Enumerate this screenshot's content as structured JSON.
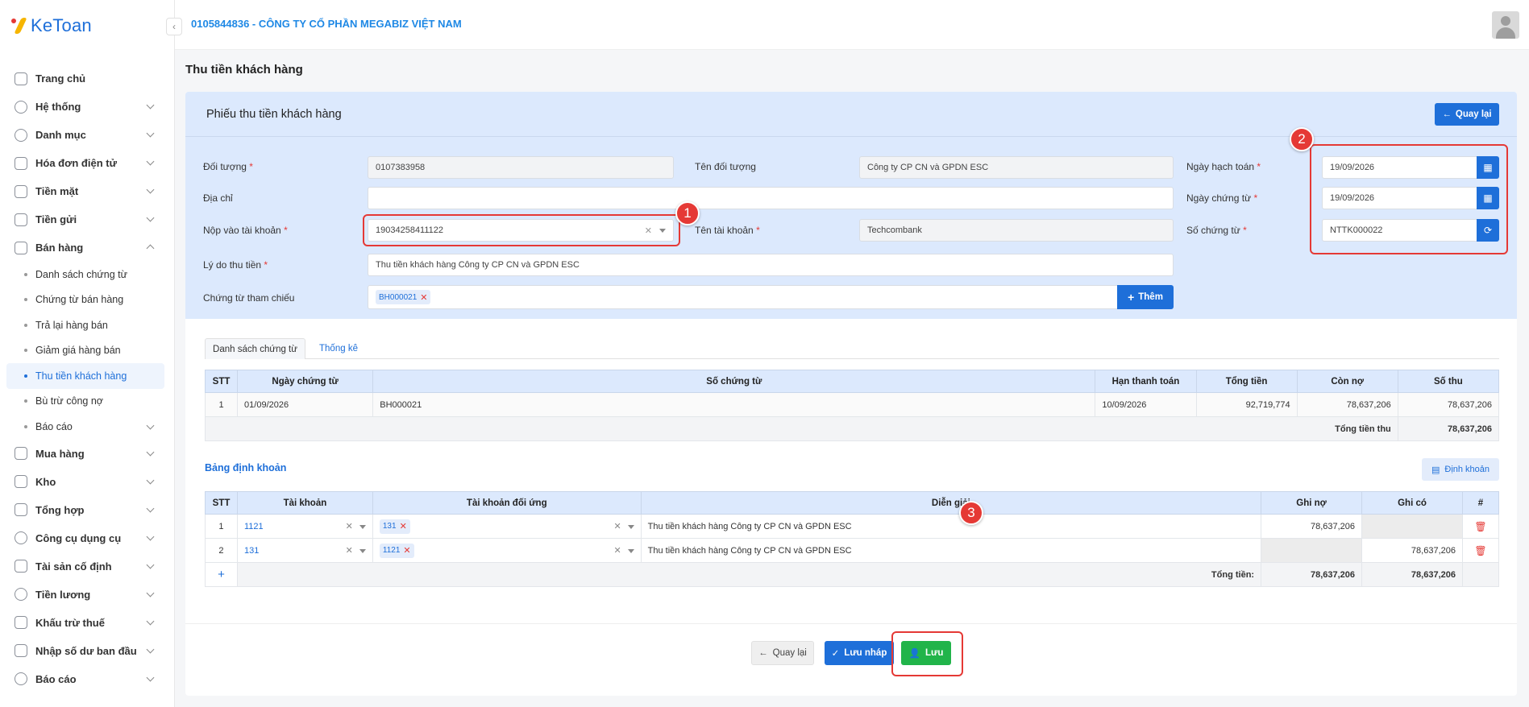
{
  "app": {
    "logo": "KeToan",
    "company": "0105844836 - CÔNG TY CỔ PHẦN MEGABIZ VIỆT NAM"
  },
  "sidebar": {
    "items": [
      {
        "label": "Trang chủ",
        "icon": "home-icon",
        "expand": ""
      },
      {
        "label": "Hệ thống",
        "icon": "gear-icon",
        "expand": "down"
      },
      {
        "label": "Danh mục",
        "icon": "grid-icon",
        "expand": "down"
      },
      {
        "label": "Hóa đơn điện tử",
        "icon": "invoice-icon",
        "expand": "down"
      },
      {
        "label": "Tiền mặt",
        "icon": "cash-icon",
        "expand": "down"
      },
      {
        "label": "Tiền gửi",
        "icon": "bank-icon",
        "expand": "down"
      },
      {
        "label": "Bán hàng",
        "icon": "sales-icon",
        "expand": "up"
      }
    ],
    "sales_sub": [
      {
        "label": "Danh sách chứng từ"
      },
      {
        "label": "Chứng từ bán hàng"
      },
      {
        "label": "Trả lại hàng bán"
      },
      {
        "label": "Giảm giá hàng bán"
      },
      {
        "label": "Thu tiền khách hàng"
      },
      {
        "label": "Bù trừ công nợ"
      },
      {
        "label": "Báo cáo"
      }
    ],
    "items_after": [
      {
        "label": "Mua hàng",
        "icon": "cart-icon"
      },
      {
        "label": "Kho",
        "icon": "warehouse-icon"
      },
      {
        "label": "Tổng hợp",
        "icon": "chart-line-icon"
      },
      {
        "label": "Công cụ dụng cụ",
        "icon": "tools-icon"
      },
      {
        "label": "Tài sản cố định",
        "icon": "car-icon"
      },
      {
        "label": "Tiền lương",
        "icon": "dollar-icon"
      },
      {
        "label": "Khấu trừ thuế",
        "icon": "tax-icon"
      },
      {
        "label": "Nhập số dư ban đầu",
        "icon": "balance-icon"
      },
      {
        "label": "Báo cáo",
        "icon": "report-icon"
      }
    ]
  },
  "page": {
    "title": "Thu tiền khách hàng"
  },
  "form": {
    "card_title": "Phiếu thu tiền khách hàng",
    "back_label": "Quay lại",
    "req": "*",
    "doi_tuong": {
      "label": "Đối tượng",
      "value": "0107383958"
    },
    "ten_doi_tuong": {
      "label": "Tên đối tượng",
      "value": "Công ty CP CN và GPDN ESC"
    },
    "ngay_hach_toan": {
      "label": "Ngày hạch toán",
      "value": "19/09/2026"
    },
    "dia_chi": {
      "label": "Địa chỉ",
      "value": ""
    },
    "ngay_chung_tu": {
      "label": "Ngày chứng từ",
      "value": "19/09/2026"
    },
    "nop_vao_tk": {
      "label": "Nộp vào tài khoản",
      "value": "19034258411122"
    },
    "ten_tk": {
      "label": "Tên tài khoản",
      "value": "Techcombank"
    },
    "so_chung_tu": {
      "label": "Số chứng từ",
      "value": "NTTK000022"
    },
    "ly_do": {
      "label": "Lý do thu tiền",
      "value": "Thu tiền khách hàng Công ty CP CN và GPDN ESC"
    },
    "tham_chieu": {
      "label": "Chứng từ tham chiếu",
      "tag": "BH000021",
      "add_label": "Thêm"
    }
  },
  "markers": [
    "1",
    "2",
    "3"
  ],
  "tabs": [
    {
      "label": "Danh sách chứng từ"
    },
    {
      "label": "Thống kê"
    }
  ],
  "doc_table": {
    "headers": [
      "STT",
      "Ngày chứng từ",
      "Số chứng từ",
      "Hạn thanh toán",
      "Tổng tiền",
      "Còn nợ",
      "Số thu"
    ],
    "rows": [
      [
        "1",
        "01/09/2026",
        "BH000021",
        "10/09/2026",
        "92,719,774",
        "78,637,206",
        "78,637,206"
      ]
    ],
    "total_label": "Tổng tiền thu",
    "total_value": "78,637,206"
  },
  "ledger": {
    "title": "Bảng định khoản",
    "button": "Định khoản",
    "headers": [
      "STT",
      "Tài khoản",
      "Tài khoản đối ứng",
      "Diễn giải",
      "Ghi nợ",
      "Ghi có",
      "#"
    ],
    "rows": [
      {
        "stt": "1",
        "tk": "1121",
        "tk_du": "131",
        "dien_giai": "Thu tiền khách hàng Công ty CP CN và GPDN ESC",
        "no": "78,637,206",
        "co": ""
      },
      {
        "stt": "2",
        "tk": "131",
        "tk_du": "1121",
        "dien_giai": "Thu tiền khách hàng Công ty CP CN và GPDN ESC",
        "no": "",
        "co": "78,637,206"
      }
    ],
    "add": "+",
    "total_label": "Tổng tiền:",
    "total_no": "78,637,206",
    "total_co": "78,637,206"
  },
  "footer": {
    "back": "Quay lại",
    "draft": "Lưu nháp",
    "save": "Lưu"
  },
  "colors": {
    "primary": "#1e6fd9",
    "success": "#21b44a",
    "danger": "#e53935",
    "header_bg": "#dce9fd"
  }
}
